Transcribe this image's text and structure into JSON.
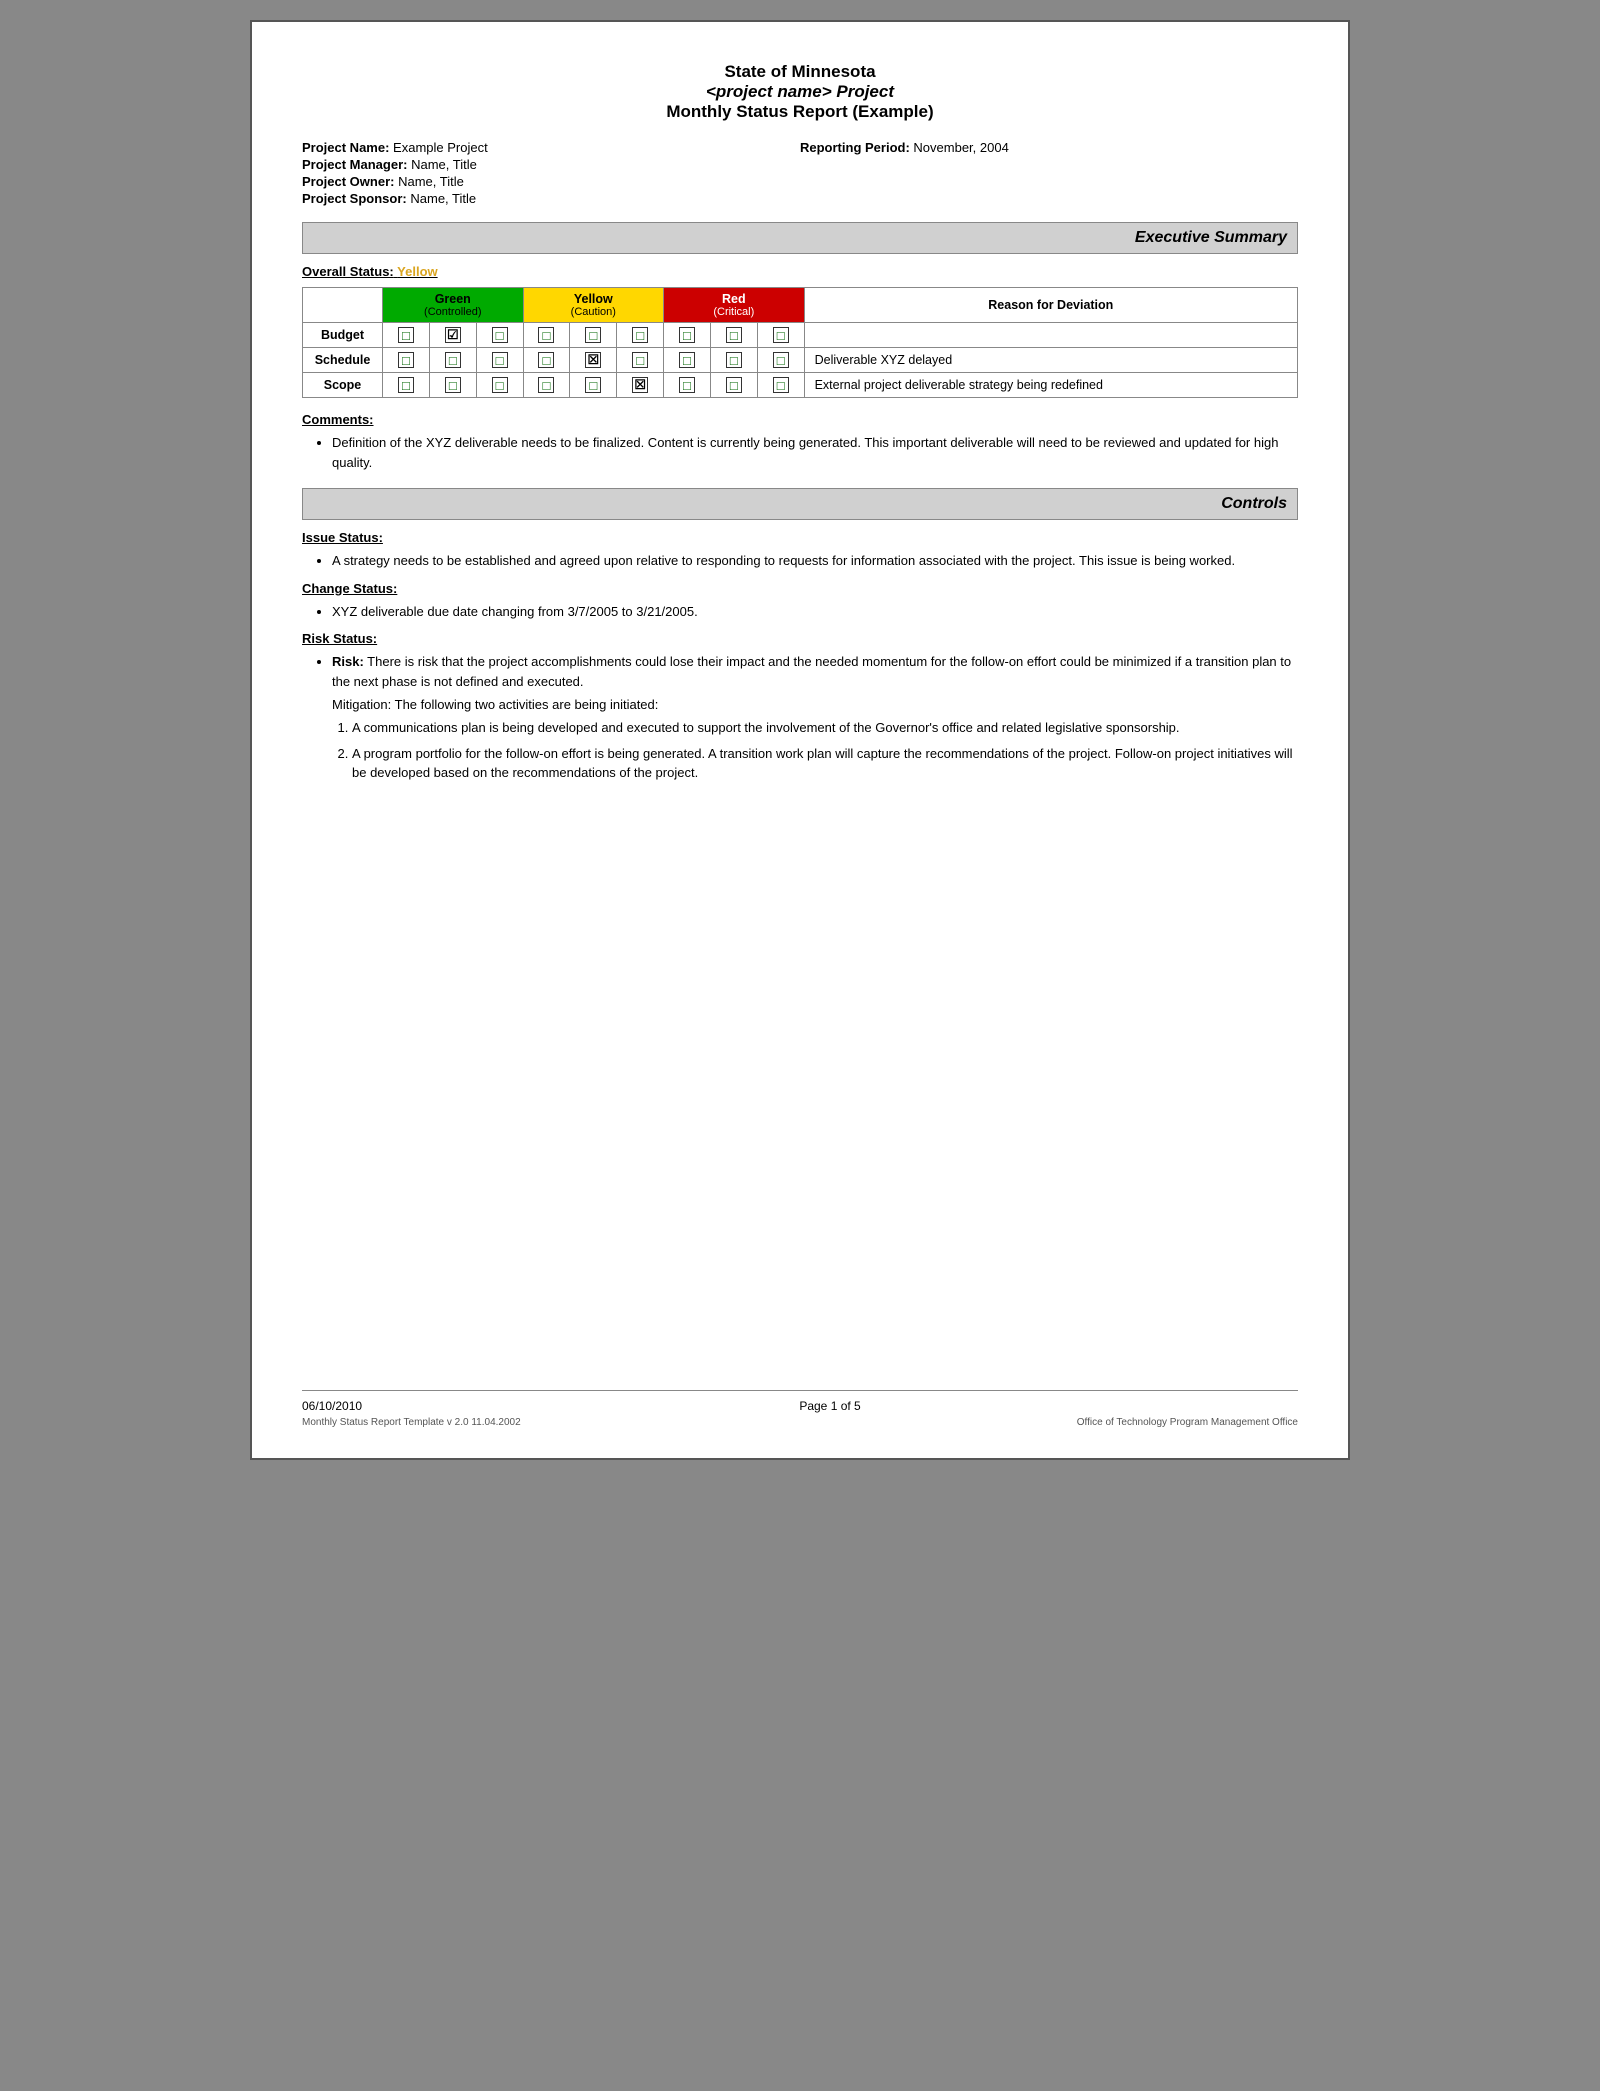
{
  "doc": {
    "title_line1": "State of Minnesota",
    "title_line2": "<project name> Project",
    "title_line3": "Monthly Status Report (Example)"
  },
  "meta": {
    "project_name_label": "Project Name:",
    "project_name_value": "Example Project",
    "reporting_period_label": "Reporting Period:",
    "reporting_period_value": "November, 2004",
    "project_manager_label": "Project Manager:",
    "project_manager_value": "Name, Title",
    "project_owner_label": "Project Owner:",
    "project_owner_value": "Name, Title",
    "project_sponsor_label": "Project Sponsor:",
    "project_sponsor_value": "Name, Title"
  },
  "executive_summary": {
    "section_title": "Executive Summary",
    "overall_status_label": "Overall Status:",
    "overall_status_value": "Yellow",
    "table": {
      "headers": {
        "col1": "",
        "green_label": "Green",
        "green_sub": "(Controlled)",
        "yellow_label": "Yellow",
        "yellow_sub": "(Caution)",
        "red_label": "Red",
        "red_sub": "(Critical)",
        "reason_label": "Reason for Deviation"
      },
      "rows": [
        {
          "label": "Budget",
          "green_checked": [
            false,
            true,
            false
          ],
          "yellow_checked": [
            false,
            false,
            false
          ],
          "red_checked": [
            false,
            false,
            false
          ],
          "reason": ""
        },
        {
          "label": "Schedule",
          "green_checked": [
            false,
            false,
            false
          ],
          "yellow_checked": [
            false,
            true,
            false
          ],
          "red_checked": [
            false,
            false,
            false
          ],
          "reason": "Deliverable XYZ delayed"
        },
        {
          "label": "Scope",
          "green_checked": [
            false,
            false,
            false
          ],
          "yellow_checked": [
            false,
            false,
            true
          ],
          "red_checked": [
            false,
            false,
            false
          ],
          "reason": "External project deliverable strategy being redefined"
        }
      ]
    },
    "comments_label": "Comments:",
    "comments": [
      "Definition of the XYZ deliverable needs to be finalized.  Content is currently being generated.  This important deliverable will need to be reviewed and updated for high quality."
    ]
  },
  "controls": {
    "section_title": "Controls",
    "issue_status_label": "Issue Status:",
    "issue_bullets": [
      "A strategy needs to be established and agreed upon relative to responding to requests for information associated with the project.  This issue is being worked."
    ],
    "change_status_label": "Change Status:",
    "change_bullets": [
      "XYZ deliverable due date changing from 3/7/2005 to 3/21/2005."
    ],
    "risk_status_label": "Risk Status:",
    "risk_bold": "Risk:",
    "risk_text": " There is risk that the project accomplishments could lose their impact and the needed momentum for the follow-on effort could be minimized if a transition plan to the next phase is not defined and executed.",
    "mitigation_bold": "Mitigation:",
    "mitigation_intro": " The following two activities are being initiated:",
    "mitigation_items": [
      "A communications plan is being developed and executed to support the involvement of the Governor's office and related legislative sponsorship.",
      "A program portfolio for the follow-on effort is being generated. A transition work plan will capture the recommendations of the project. Follow-on project initiatives will be developed based on the recommendations of the project."
    ]
  },
  "footer": {
    "date": "06/10/2010",
    "page_label": "Page 1 of 5",
    "template_info": "Monthly Status Report Template  v 2.0  11.04.2002",
    "office": "Office of Technology Program Management Office"
  }
}
